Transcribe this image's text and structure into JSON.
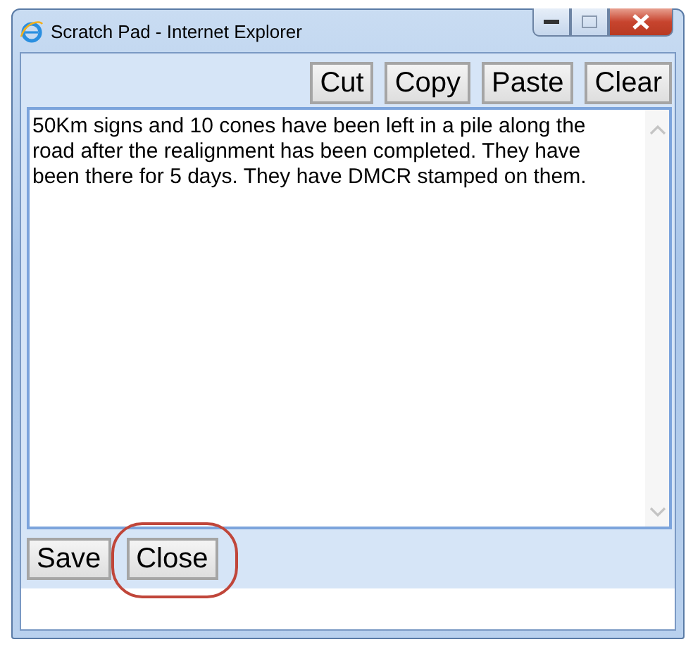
{
  "window": {
    "title": "Scratch Pad - Internet Explorer"
  },
  "toolbar": {
    "buttons": [
      {
        "label": "Cut"
      },
      {
        "label": "Copy"
      },
      {
        "label": "Paste"
      },
      {
        "label": "Clear"
      }
    ]
  },
  "notes": {
    "value": "50Km signs and 10 cones have been left in a pile along the road after the realignment has been completed. They have been there for 5 days. They have DMCR stamped on them."
  },
  "footer": {
    "buttons": [
      {
        "label": "Save",
        "highlighted": false
      },
      {
        "label": "Close",
        "highlighted": true
      }
    ]
  }
}
